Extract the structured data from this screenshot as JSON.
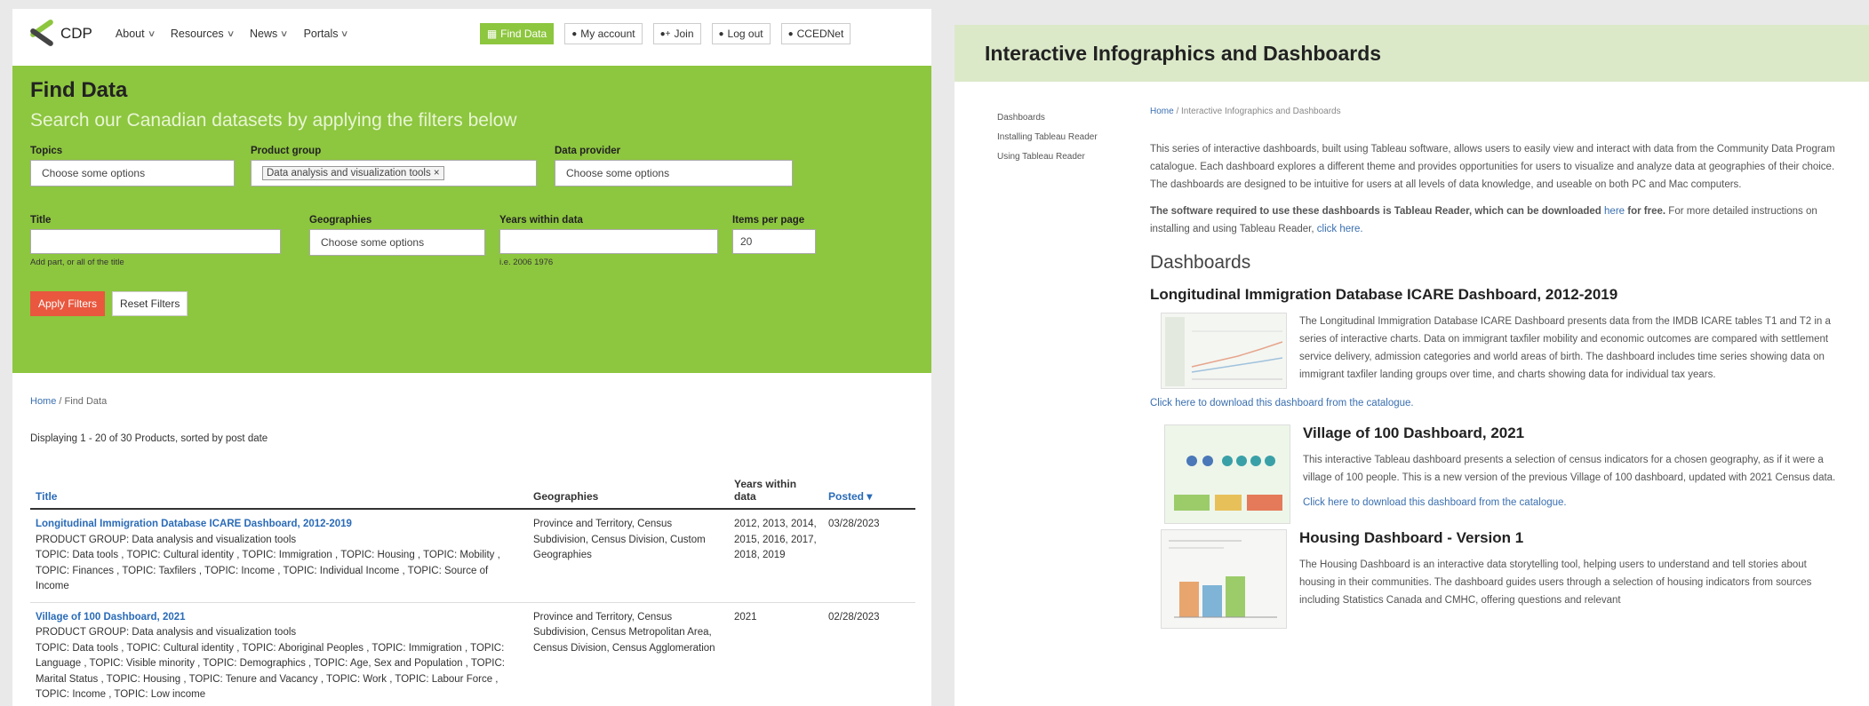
{
  "nav": {
    "brand": "CDP",
    "items": [
      "About",
      "Resources",
      "News",
      "Portals"
    ],
    "buttons": {
      "find_data": "Find Data",
      "my_account": "My account",
      "join": "Join",
      "log_out": "Log out",
      "ccednet": "CCEDNet"
    }
  },
  "filter": {
    "title": "Find Data",
    "subtitle": "Search our Canadian datasets by applying the filters below",
    "topics_label": "Topics",
    "topics_value": "Choose some options",
    "product_group_label": "Product group",
    "product_group_chip": "Data analysis and visualization tools ×",
    "data_provider_label": "Data provider",
    "data_provider_value": "Choose some options",
    "title_label": "Title",
    "title_hint": "Add part, or all of the title",
    "geographies_label": "Geographies",
    "geographies_value": "Choose some options",
    "years_label": "Years within data",
    "years_hint": "i.e. 2006 1976",
    "items_label": "Items per page",
    "items_value": "20",
    "apply_label": "Apply Filters",
    "reset_label": "Reset Filters"
  },
  "results": {
    "breadcrumb_home": "Home",
    "breadcrumb_sep": "/",
    "breadcrumb_current": "Find Data",
    "displaying": "Displaying 1 - 20 of 30 Products, sorted by post date",
    "headers": {
      "title": "Title",
      "geographies": "Geographies",
      "years": "Years within data",
      "posted": "Posted ▾"
    },
    "rows": [
      {
        "title": "Longitudinal Immigration Database ICARE Dashboard, 2012-2019",
        "product_group": "PRODUCT GROUP: Data analysis and visualization tools",
        "topics": "TOPIC: Data tools , TOPIC: Cultural identity , TOPIC: Immigration , TOPIC: Housing , TOPIC: Mobility , TOPIC: Finances , TOPIC: Taxfilers , TOPIC: Income , TOPIC: Individual Income , TOPIC: Source of Income",
        "geographies": "Province and Territory, Census Subdivision, Census Division, Custom Geographies",
        "years": "2012, 2013, 2014, 2015, 2016, 2017, 2018, 2019",
        "posted": "03/28/2023"
      },
      {
        "title": "Village of 100 Dashboard, 2021",
        "product_group": "PRODUCT GROUP: Data analysis and visualization tools",
        "topics": "TOPIC: Data tools , TOPIC: Cultural identity , TOPIC: Aboriginal Peoples , TOPIC: Immigration , TOPIC: Language , TOPIC: Visible minority , TOPIC: Demographics , TOPIC: Age, Sex and Population , TOPIC: Marital Status , TOPIC: Housing , TOPIC: Tenure and Vacancy , TOPIC: Work , TOPIC: Labour Force , TOPIC: Income , TOPIC: Low income",
        "geographies": "Province and Territory, Census Subdivision, Census Metropolitan Area, Census Division, Census Agglomeration",
        "years": "2021",
        "posted": "02/28/2023"
      }
    ]
  },
  "right": {
    "header": "Interactive Infographics and Dashboards",
    "side_links": [
      "Dashboards",
      "Installing Tableau Reader",
      "Using Tableau Reader"
    ],
    "crumb_home": "Home",
    "crumb_sep": "/",
    "crumb_current": "Interactive Infographics and Dashboards",
    "intro": "This series of interactive dashboards, built using Tableau software, allows users to easily view and interact with data from the Community Data Program catalogue. Each dashboard explores a different theme and provides opportunities for users to visualize and analyze data at geographies of their choice. The dashboards are designed to be intuitive for users at all levels of data knowledge, and useable on both PC and Mac computers.",
    "software_bold": "The software required to use these dashboards is Tableau Reader, which can be downloaded",
    "here": "here",
    "for_free": "for free.",
    "more_detail": "For more detailed instructions on installing and using Tableau Reader,",
    "click_here": "click here.",
    "dashboards_heading": "Dashboards",
    "dashboards": [
      {
        "title": "Longitudinal Immigration Database ICARE Dashboard, 2012-2019",
        "text": "The Longitudinal Immigration Database ICARE Dashboard presents data from the IMDB ICARE tables T1 and T2 in a series of interactive charts. Data on immigrant taxfiler mobility and economic outcomes are compared with settlement service delivery, admission categories and world areas of birth. The dashboard includes time series showing data on immigrant taxfiler landing groups over time, and charts showing data for individual tax years.",
        "link": "Click here to download this dashboard from the catalogue."
      },
      {
        "title": "Village of 100 Dashboard, 2021",
        "text": "This interactive Tableau dashboard presents a selection of census indicators for a chosen geography, as if it were a village of 100 people. This is a new version of the previous Village of 100 dashboard, updated with 2021 Census data.",
        "link": "Click here to download this dashboard from the catalogue."
      },
      {
        "title": "Housing Dashboard - Version 1",
        "text": "The Housing Dashboard is an interactive data storytelling tool, helping users to understand and tell stories about housing in their communities. The dashboard guides users through a selection of housing indicators from sources including Statistics Canada and CMHC, offering questions and relevant",
        "link": ""
      }
    ]
  },
  "colors": {
    "green": "#8dc63f",
    "light_green": "#dbe9c9",
    "link_blue": "#2a6bb8",
    "apply_red": "#e9573e"
  }
}
